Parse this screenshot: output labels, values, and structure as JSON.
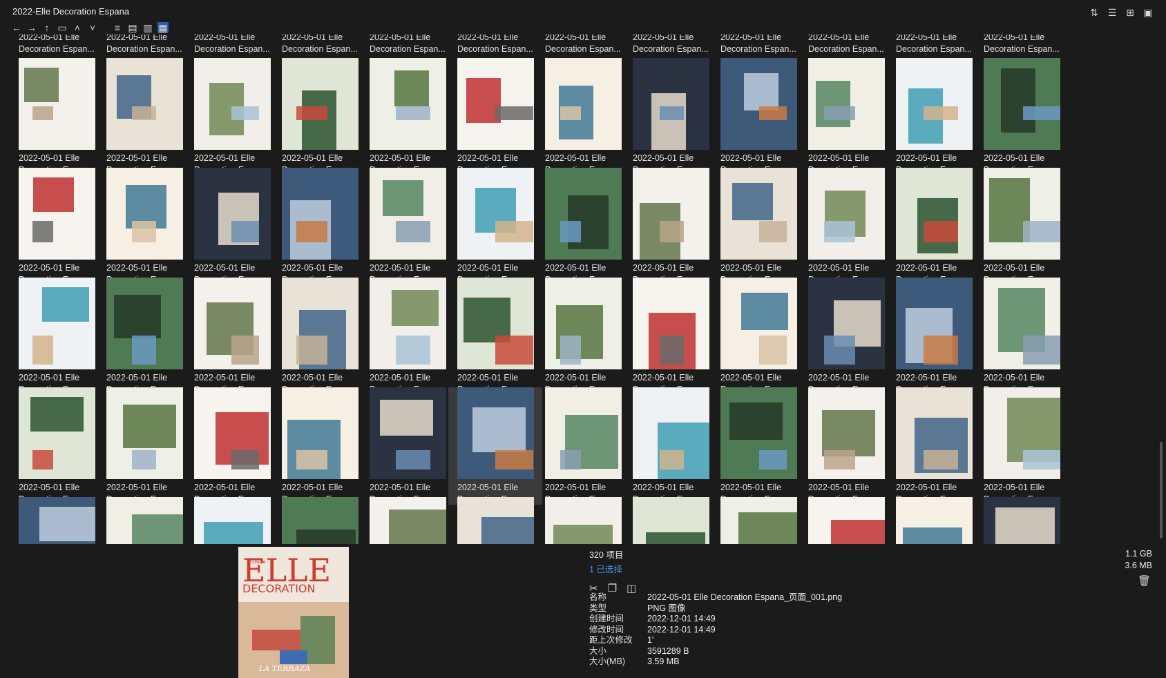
{
  "window": {
    "title": "2022-Elle Decoration Espana"
  },
  "toolbar": {
    "back_icon": "arrow-left-icon",
    "forward_icon": "arrow-right-icon",
    "up_icon": "arrow-up-icon"
  },
  "grid": {
    "item_label_line1": "2022-05-01 Elle",
    "item_label_line2": "Decoration Espan...",
    "rows": 5,
    "cols": 12,
    "selected_row": 3,
    "selected_col": 5
  },
  "status": {
    "item_count": "320 项目",
    "selected_count": "1 已选择",
    "total_size": "1.1 GB",
    "selected_size": "3.6 MB"
  },
  "properties": [
    {
      "key": "名称",
      "value": "2022-05-01 Elle Decoration Espana_页面_001.png"
    },
    {
      "key": "类型",
      "value": "PNG 图像"
    },
    {
      "key": "创建时间",
      "value": "2022-12-01  14:49"
    },
    {
      "key": "修改时间",
      "value": "2022-12-01  14:49"
    },
    {
      "key": "距上次修改",
      "value": "1'"
    },
    {
      "key": "大小",
      "value": "3591289 B"
    },
    {
      "key": "大小(MB)",
      "value": "3.59 MB"
    }
  ],
  "preview": {
    "brand": "ELLE",
    "word": "DECORATION",
    "edition": "ESPAÑA",
    "footer": "LA TERRAZA"
  },
  "colors": {
    "accent": "#2e5fa8",
    "selected_text": "#4d8fe0",
    "background": "#1b1b1b"
  }
}
